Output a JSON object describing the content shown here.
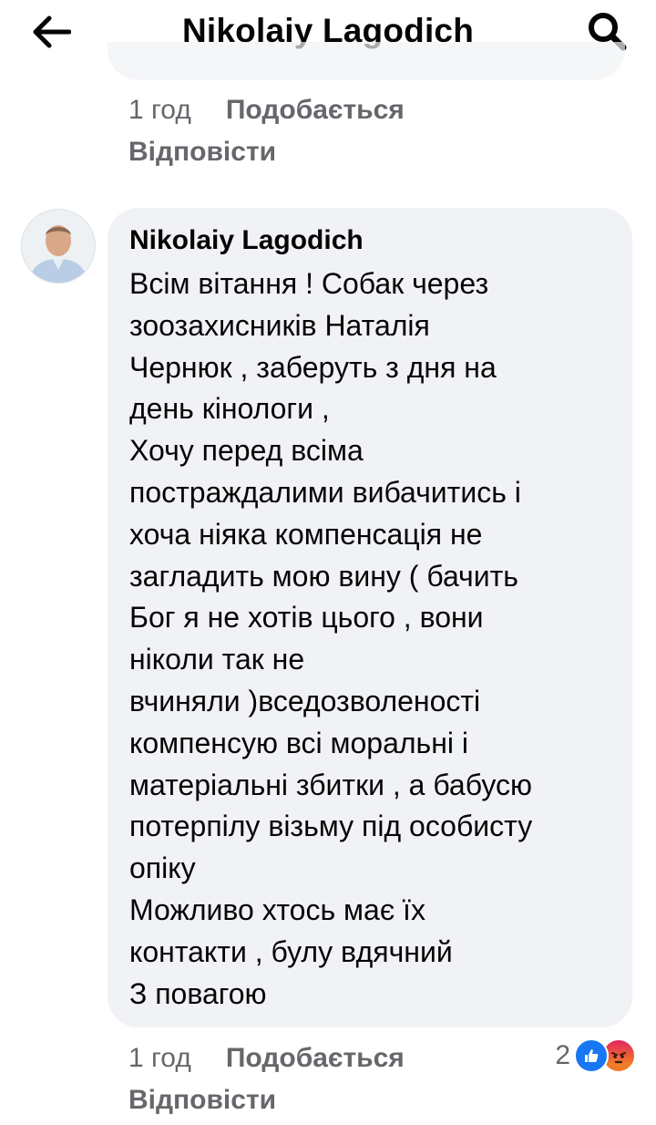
{
  "header": {
    "title": "Nikolaiy Lagodich"
  },
  "previous_comment": {
    "time": "1 год",
    "like_label": "Подобається",
    "reply_label": "Відповісти"
  },
  "comment": {
    "author": "Nikolaiy Lagodich",
    "lines": [
      "Всім вітання ! Собак через",
      "зоозахисників Наталія",
      "Чернюк , заберуть з дня на",
      "день кінологи ,",
      "Хочу перед всіма",
      "постраждалими вибачитись і",
      "хоча ніяка компенсація не",
      "загладить мою вину ( бачить",
      "Бог я не хотів цього , вони",
      "ніколи так не",
      "вчиняли )вседозволеності",
      "компенсую всі моральні і",
      "матеріальні збитки , а бабусю",
      "потерпілу візьму під особисту",
      "опіку",
      "Можливо хтось має їх",
      "контакти , булу вдячний",
      "З повагою"
    ],
    "time": "1 год",
    "like_label": "Подобається",
    "reply_label": "Відповісти",
    "reaction_count": "2",
    "reaction_icons": [
      "like-reaction-icon",
      "angry-reaction-icon"
    ]
  },
  "colors": {
    "bubble": "#f0f2f5",
    "secondary_text": "#65676b",
    "like_blue": "#1877f2"
  }
}
